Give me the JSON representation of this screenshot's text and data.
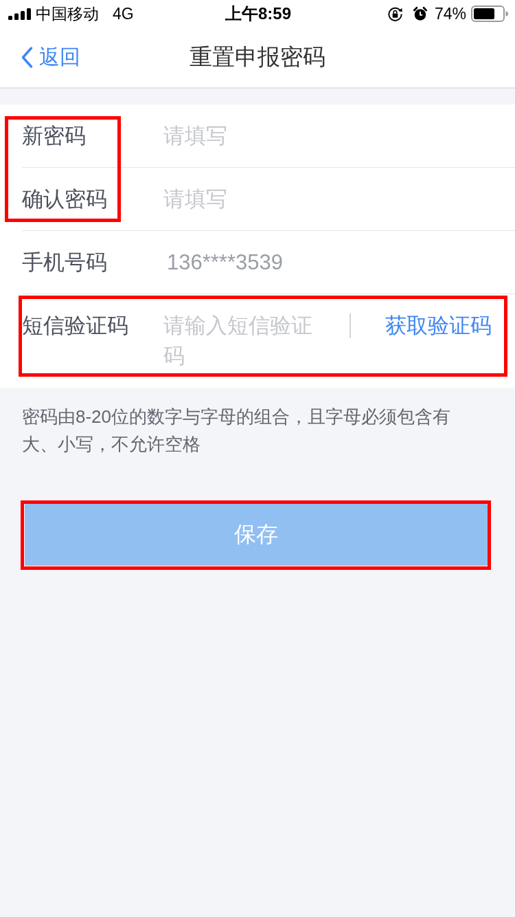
{
  "status_bar": {
    "carrier": "中国移动",
    "network": "4G",
    "time": "上午8:59",
    "battery_percent": "74%"
  },
  "nav": {
    "back": "返回",
    "title": "重置申报密码"
  },
  "form": {
    "rows": [
      {
        "kind": "input",
        "label": "新密码",
        "placeholder": "请填写",
        "label_highlighted": true,
        "row_highlighted": false
      },
      {
        "kind": "input",
        "label": "确认密码",
        "placeholder": "请填写",
        "label_highlighted": true,
        "row_highlighted": false
      },
      {
        "kind": "readonly",
        "label": "手机号码",
        "value": "136****3539",
        "label_highlighted": false,
        "row_highlighted": false
      },
      {
        "kind": "code",
        "label": "短信验证码",
        "placeholder": "请输入短信验证码",
        "action": "获取验证码",
        "label_highlighted": false,
        "row_highlighted": true
      }
    ]
  },
  "hint": "密码由8-20位的数字与字母的组合，且字母必须包含有大、小写，不允许空格",
  "save_button": {
    "label": "保存",
    "disabled": true,
    "highlighted": true
  }
}
